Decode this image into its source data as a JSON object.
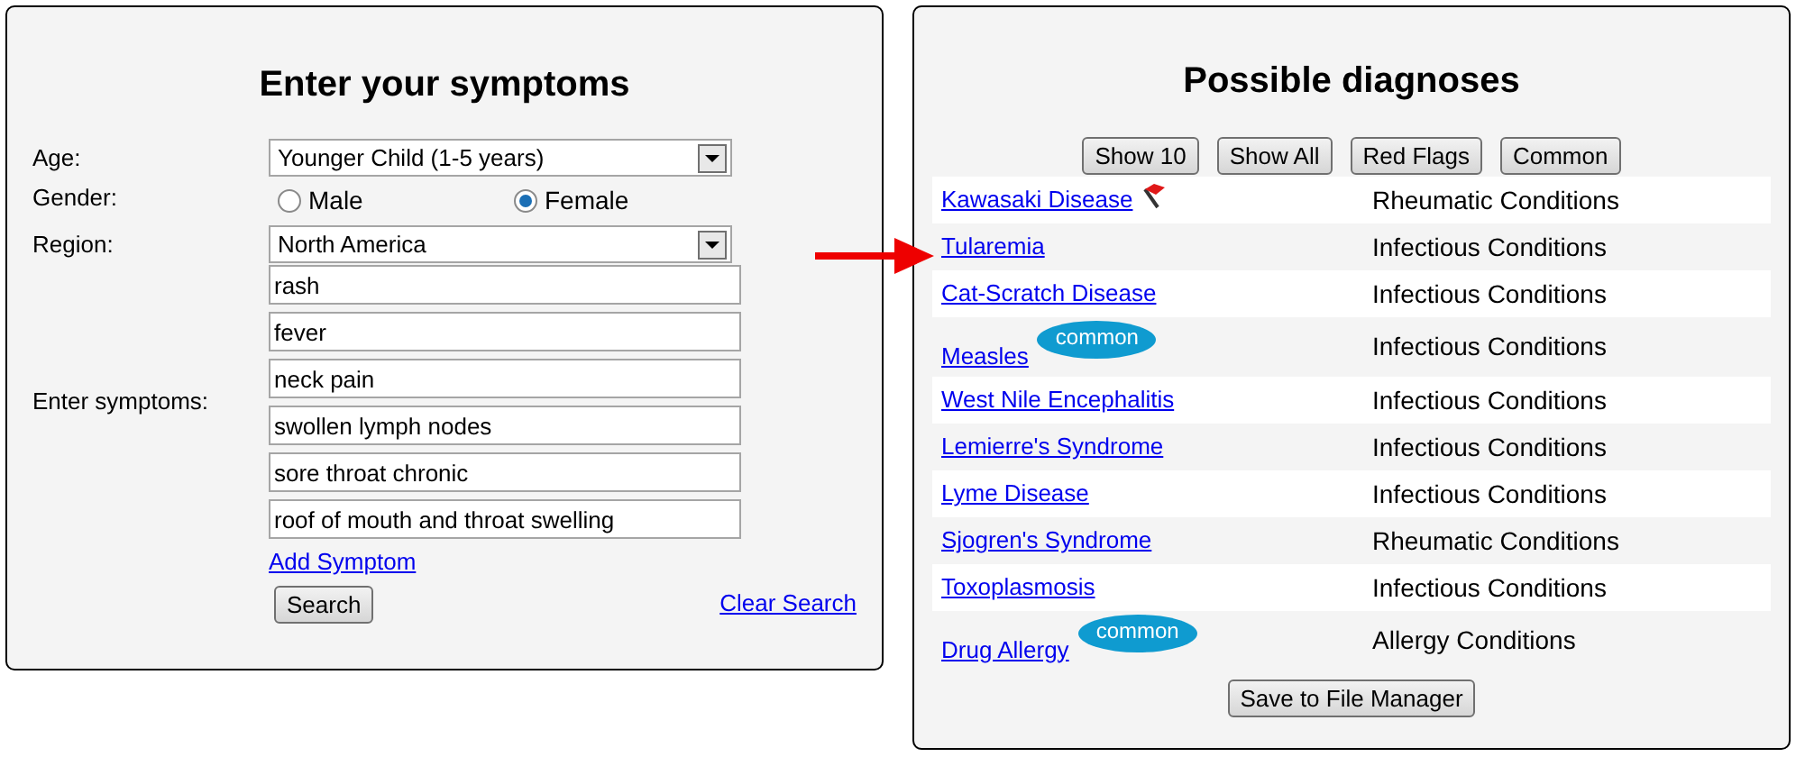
{
  "symptom_form": {
    "title": "Enter your symptoms",
    "age": {
      "label": "Age:",
      "value": "Younger Child (1-5 years)"
    },
    "gender": {
      "label": "Gender:",
      "options": [
        {
          "label": "Male",
          "selected": false
        },
        {
          "label": "Female",
          "selected": true
        }
      ]
    },
    "region": {
      "label": "Region:",
      "value": "North America"
    },
    "symptoms": {
      "label": "Enter symptoms:",
      "values": [
        "rash",
        "fever",
        "neck pain",
        "swollen lymph nodes",
        "sore throat chronic",
        "roof of mouth and throat swelling"
      ]
    },
    "add_link": "Add Symptom",
    "search_button": "Search",
    "clear_link": "Clear Search"
  },
  "diagnoses": {
    "title": "Possible diagnoses",
    "filters": [
      "Show 10",
      "Show All",
      "Red Flags",
      "Common"
    ],
    "rows": [
      {
        "name": "Kawasaki Disease",
        "category": "Rheumatic Conditions",
        "red_flag": true,
        "badge": null
      },
      {
        "name": "Tularemia",
        "category": "Infectious Conditions",
        "red_flag": false,
        "badge": null
      },
      {
        "name": "Cat-Scratch Disease",
        "category": "Infectious Conditions",
        "red_flag": false,
        "badge": null
      },
      {
        "name": "Measles",
        "category": "Infectious Conditions",
        "red_flag": false,
        "badge": "common"
      },
      {
        "name": "West Nile Encephalitis",
        "category": "Infectious Conditions",
        "red_flag": false,
        "badge": null
      },
      {
        "name": "Lemierre's Syndrome",
        "category": "Infectious Conditions",
        "red_flag": false,
        "badge": null
      },
      {
        "name": "Lyme Disease",
        "category": "Infectious Conditions",
        "red_flag": false,
        "badge": null
      },
      {
        "name": "Sjogren's Syndrome",
        "category": "Rheumatic Conditions",
        "red_flag": false,
        "badge": null
      },
      {
        "name": "Toxoplasmosis",
        "category": "Infectious Conditions",
        "red_flag": false,
        "badge": null
      },
      {
        "name": "Drug Allergy",
        "category": "Allergy Conditions",
        "red_flag": false,
        "badge": "common"
      }
    ],
    "save_button": "Save to File Manager"
  }
}
